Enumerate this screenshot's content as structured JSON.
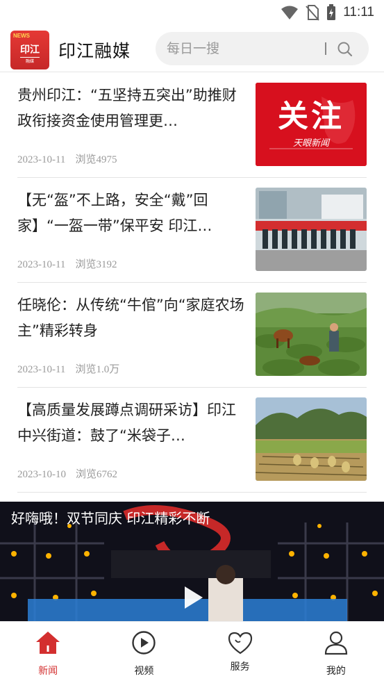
{
  "status_bar": {
    "time": "11:11"
  },
  "header": {
    "logo_top": "NEWS",
    "logo_name": "印江",
    "logo_sub": "融媒",
    "app_title": "印江融媒",
    "search_placeholder": "每日一搜"
  },
  "news": [
    {
      "title": "贵州印江：“五坚持五突出”助推财政衔接资金使用管理更…",
      "date": "2023-10-11",
      "views": "浏览4975",
      "thumb_text": "关注",
      "thumb_sub": "天眼新闻"
    },
    {
      "title": "【无“盔”不上路，安全“戴”回家】“一盔一带”保平安 印江…",
      "date": "2023-10-11",
      "views": "浏览3192"
    },
    {
      "title": "任晓伦：从传统“牛倌”向“家庭农场主”精彩转身",
      "date": "2023-10-11",
      "views": "浏览1.0万"
    },
    {
      "title": "【高质量发展蹲点调研采访】印江中兴街道：鼓了“米袋子…",
      "date": "2023-10-10",
      "views": "浏览6762"
    }
  ],
  "video": {
    "title": "好嗨哦！双节同庆 印江精彩不断"
  },
  "nav": [
    {
      "label": "新闻",
      "icon": "home-icon",
      "active": true
    },
    {
      "label": "视频",
      "icon": "play-circle-icon",
      "active": false
    },
    {
      "label": "服务",
      "icon": "heart-icon",
      "active": false
    },
    {
      "label": "我的",
      "icon": "user-icon",
      "active": false
    }
  ],
  "colors": {
    "brand": "#d32f2f",
    "meta": "#9a9a9a"
  }
}
